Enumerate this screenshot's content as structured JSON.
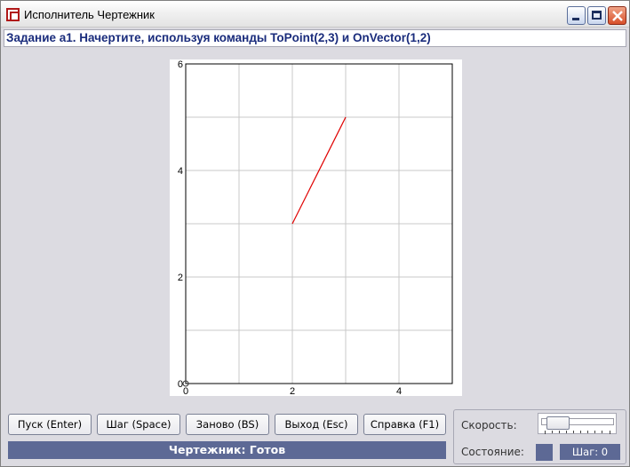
{
  "window": {
    "title": "Исполнитель Чертежник"
  },
  "task": {
    "text": "Задание а1. Начертите, используя команды ToPoint(2,3) и OnVector(1,2)"
  },
  "chart_data": {
    "type": "line",
    "xlim": [
      0,
      5
    ],
    "ylim": [
      0,
      6
    ],
    "grid": true,
    "x_ticks": [
      "0",
      "2",
      "4"
    ],
    "y_ticks": [
      "0",
      "2",
      "4",
      "6"
    ],
    "x_tick_values": [
      0,
      2,
      4
    ],
    "y_tick_values": [
      0,
      2,
      4,
      6
    ],
    "series": [
      {
        "x": [
          2,
          3
        ],
        "y": [
          3,
          5
        ],
        "color": "#e00000"
      }
    ],
    "origin_marker": true
  },
  "buttons": {
    "run": "Пуск (Enter)",
    "step": "Шаг (Space)",
    "restart": "Заново (BS)",
    "exit": "Выход (Esc)",
    "help": "Справка (F1)"
  },
  "status": {
    "text": "Чертежник: Готов"
  },
  "panel": {
    "speed_label": "Скорость:",
    "state_label": "Состояние:",
    "step_counter": "Шаг: 0",
    "speed_fraction": 0.1
  },
  "colors": {
    "accent": "#5d6995",
    "task_text": "#1a2c7c",
    "drawn_line": "#e00000"
  }
}
